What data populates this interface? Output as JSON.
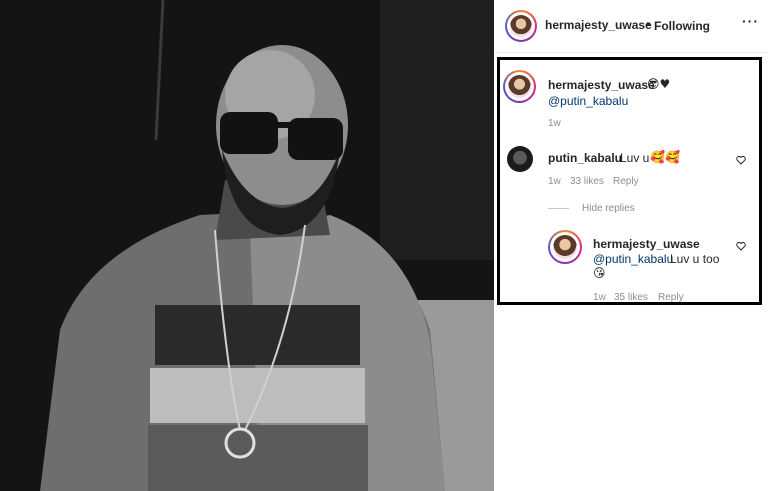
{
  "header": {
    "username": "hermajesty_uwase",
    "separator": "•",
    "follow_status": "Following",
    "more": "···"
  },
  "caption": {
    "username": "hermajesty_uwase",
    "emoji": "😎♥",
    "mention": "@putin_kabalu",
    "time": "1w"
  },
  "comments": [
    {
      "username": "putin_kabalu",
      "text": "Luv u",
      "emoji": "🥰🥰",
      "time": "1w",
      "likes": "33 likes",
      "reply": "Reply"
    }
  ],
  "hide_replies": "Hide replies",
  "replies": [
    {
      "username": "hermajesty_uwase",
      "mention": "@putin_kabalu",
      "text": "Luv u too",
      "emoji": "😘",
      "time": "1w",
      "likes": "35 likes",
      "reply": "Reply"
    }
  ],
  "colors": {
    "username": "#262626",
    "mention": "#00376b",
    "meta": "#8e8e8e",
    "highlight_box": "#000000"
  },
  "icons": [
    "more-options-icon",
    "heart-icon",
    "avatar"
  ]
}
